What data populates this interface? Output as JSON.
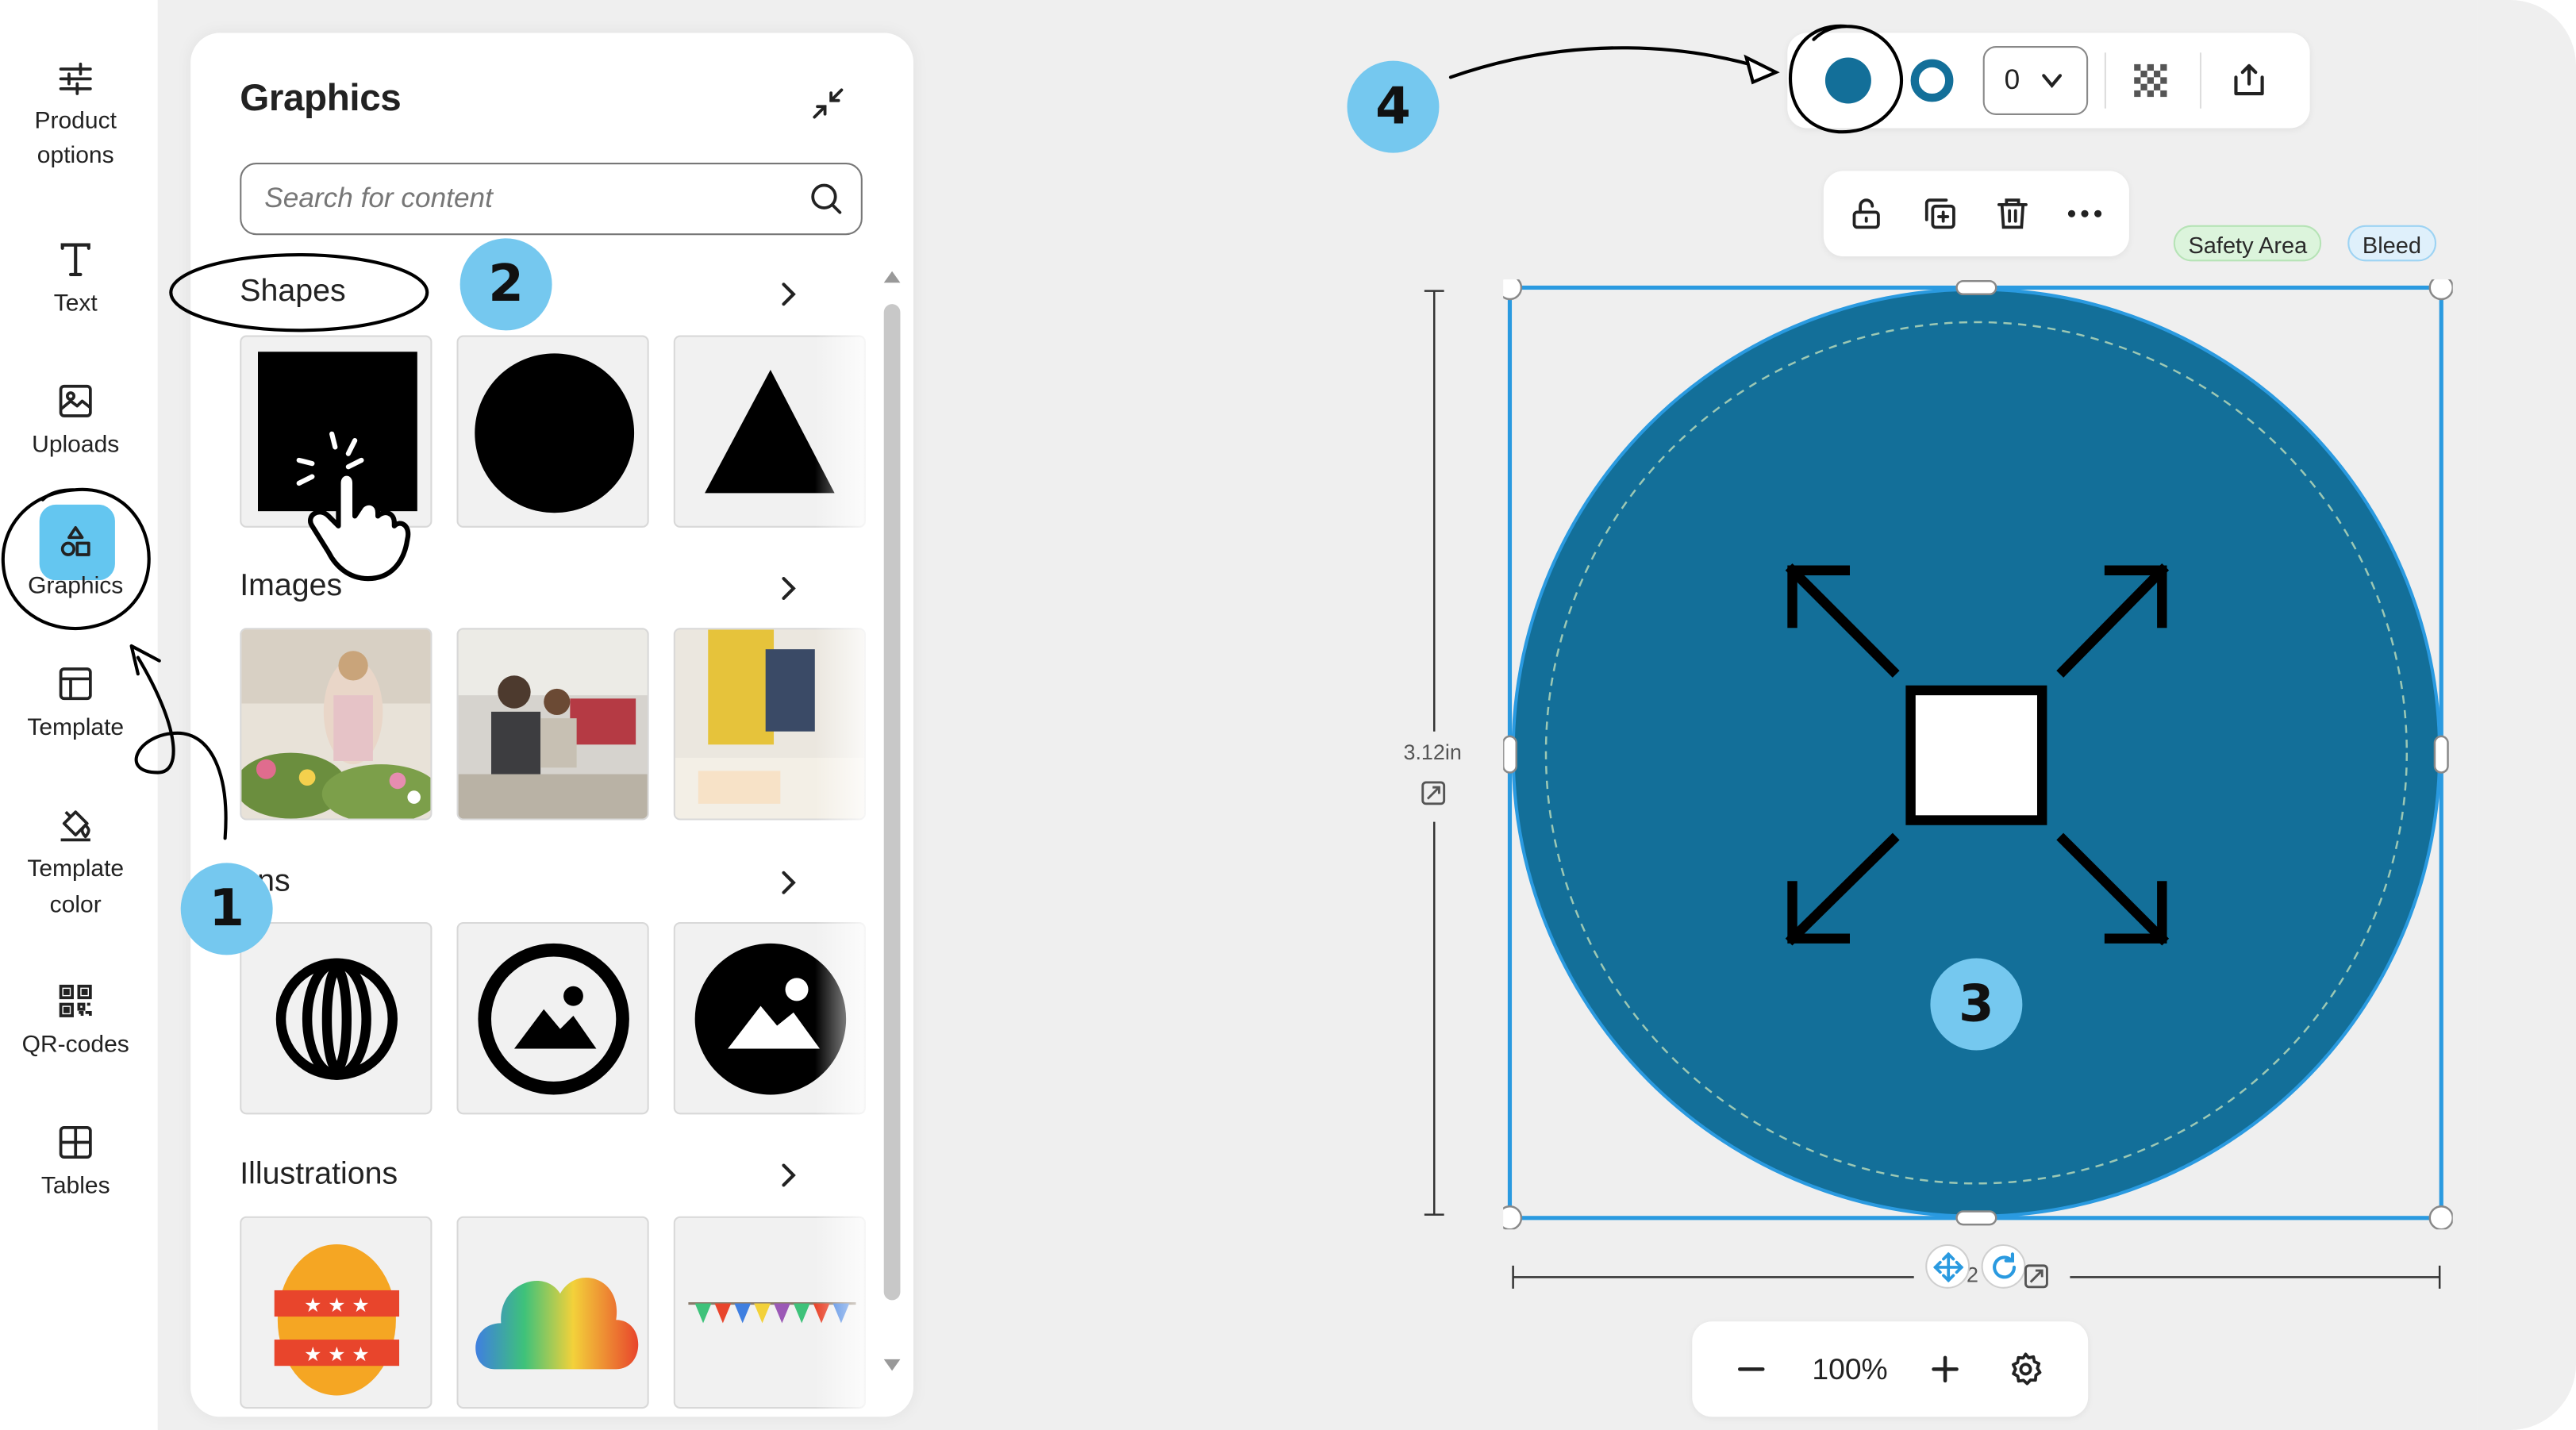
{
  "sidebar": {
    "items": [
      {
        "label": "Product options",
        "icon": "sliders-icon"
      },
      {
        "label": "Text",
        "icon": "text-icon"
      },
      {
        "label": "Uploads",
        "icon": "image-icon"
      },
      {
        "label": "Graphics",
        "icon": "shapes-icon",
        "active": true
      },
      {
        "label": "Template",
        "icon": "template-icon"
      },
      {
        "label": "Template color",
        "icon": "paint-bucket-icon"
      },
      {
        "label": "QR-codes",
        "icon": "qr-code-icon"
      },
      {
        "label": "Tables",
        "icon": "table-icon"
      }
    ]
  },
  "panel": {
    "title": "Graphics",
    "search_placeholder": "Search for content",
    "sections": [
      {
        "title": "Shapes",
        "items": [
          "square",
          "circle",
          "triangle"
        ]
      },
      {
        "title": "Images",
        "items": [
          "florist-photo",
          "office-photo",
          "business-photo"
        ]
      },
      {
        "title": "Icons",
        "visible_title": "ons",
        "items": [
          "abstract-globe",
          "image-icon-circle",
          "image-icon-solid"
        ]
      },
      {
        "title": "Illustrations",
        "items": [
          "easter-egg",
          "rainbow-cloud",
          "bunting"
        ]
      }
    ]
  },
  "style_toolbar": {
    "fill_color": "#136f99",
    "stroke_color": "#136f99",
    "stroke_width": "0"
  },
  "element_toolbar": {
    "icons": [
      "unlock-icon",
      "duplicate-icon",
      "trash-icon",
      "more-icon"
    ]
  },
  "canvas": {
    "badges": {
      "safety": "Safety Area",
      "bleed": "Bleed"
    },
    "height_label": "3.12in",
    "width_label_partial": "2",
    "shape_color": "#136f99"
  },
  "zoom": {
    "value": "100%"
  },
  "callouts": [
    "1",
    "2",
    "3",
    "4"
  ],
  "colors": {
    "accent": "#64c6f0",
    "callout": "#75c8ef",
    "selection": "#2a9ae0",
    "shape": "#136f99"
  }
}
